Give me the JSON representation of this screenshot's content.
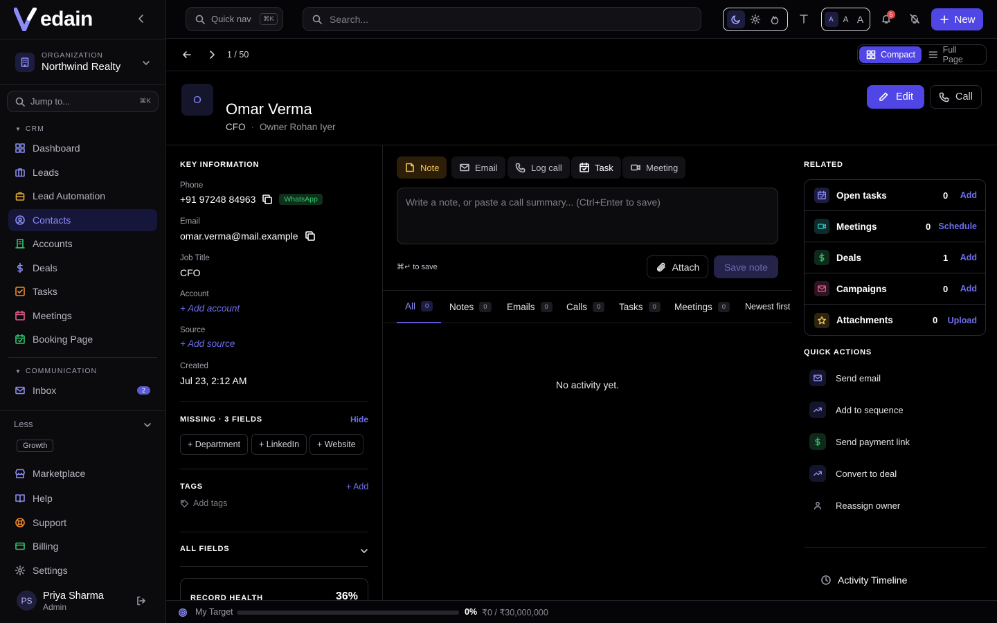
{
  "app": {
    "logo_text": "edain",
    "brand_color": "#4f46e5"
  },
  "org": {
    "label": "ORGANIZATION",
    "name": "Northwind Realty"
  },
  "sidebar": {
    "jump_placeholder": "Jump to...",
    "jump_kbd": "⌘K",
    "crm_header": "CRM",
    "crm_items": [
      {
        "label": "Dashboard",
        "icon": "grid-icon"
      },
      {
        "label": "Leads",
        "icon": "briefcase-icon"
      },
      {
        "label": "Lead Automation",
        "icon": "bag-icon"
      },
      {
        "label": "Contacts",
        "icon": "contact-icon",
        "active": true
      },
      {
        "label": "Accounts",
        "icon": "building-icon"
      },
      {
        "label": "Deals",
        "icon": "dollar-icon"
      },
      {
        "label": "Tasks",
        "icon": "checkbox-icon"
      },
      {
        "label": "Meetings",
        "icon": "calendar-icon"
      },
      {
        "label": "Booking Page",
        "icon": "calendar-check-icon"
      }
    ],
    "comm_header": "COMMUNICATION",
    "comm_items": [
      {
        "label": "Inbox",
        "icon": "mail-icon",
        "badge": "2"
      }
    ],
    "less_label": "Less",
    "plan_badge": "Growth",
    "bottom_items": [
      {
        "label": "Marketplace",
        "icon": "store-icon"
      },
      {
        "label": "Help",
        "icon": "book-icon"
      },
      {
        "label": "Support",
        "icon": "lifebuoy-icon"
      },
      {
        "label": "Billing",
        "icon": "card-icon"
      },
      {
        "label": "Settings",
        "icon": "gear-icon"
      }
    ],
    "user": {
      "initials": "PS",
      "name": "Priya Sharma",
      "role": "Admin"
    }
  },
  "topbar": {
    "quicknav_label": "Quick nav",
    "quicknav_kbd": "⌘K",
    "search_placeholder": "Search...",
    "font_sizes": [
      "A",
      "A",
      "A"
    ],
    "notif_count": "5",
    "new_label": "New"
  },
  "subheader": {
    "pager": "1 / 50",
    "view_compact": "Compact",
    "view_full": "Full Page"
  },
  "record": {
    "initial": "O",
    "name": "Omar Verma",
    "title": "CFO",
    "owner": "Owner Rohan Iyer",
    "edit_label": "Edit",
    "call_label": "Call"
  },
  "info": {
    "header": "KEY INFORMATION",
    "phone_label": "Phone",
    "phone": "+91 97248 84963",
    "whatsapp": "WhatsApp",
    "email_label": "Email",
    "email": "omar.verma@mail.example",
    "job_label": "Job Title",
    "job": "CFO",
    "account_label": "Account",
    "account_add": "+ Add account",
    "source_label": "Source",
    "source_add": "+ Add source",
    "created_label": "Created",
    "created": "Jul 23, 2:12 AM",
    "missing_header": "MISSING · 3 FIELDS",
    "hide_label": "Hide",
    "missing_chips": [
      "+ Department",
      "+ LinkedIn",
      "+ Website"
    ],
    "tags_header": "TAGS",
    "tags_add": "+ Add",
    "tags_placeholder": "Add tags",
    "all_fields_header": "ALL FIELDS",
    "health_label": "RECORD HEALTH",
    "health_value": "36%"
  },
  "composer": {
    "tabs": [
      "Note",
      "Email",
      "Log call",
      "Task",
      "Meeting"
    ],
    "placeholder": "Write a note, or paste a call summary... (Ctrl+Enter to save)",
    "hint": "⌘↵ to save",
    "attach_label": "Attach",
    "save_label": "Save note"
  },
  "activity": {
    "tabs": [
      {
        "label": "All",
        "count": "0"
      },
      {
        "label": "Notes",
        "count": "0"
      },
      {
        "label": "Emails",
        "count": "0"
      },
      {
        "label": "Calls",
        "count": "0"
      },
      {
        "label": "Tasks",
        "count": "0"
      },
      {
        "label": "Meetings",
        "count": "0"
      }
    ],
    "sort_label": "Newest first",
    "empty_text": "No activity yet."
  },
  "related": {
    "header": "RELATED",
    "items": [
      {
        "label": "Open tasks",
        "count": "0",
        "action": "Add",
        "icon": "calendar-check-icon"
      },
      {
        "label": "Meetings",
        "count": "0",
        "action": "Schedule",
        "icon": "video-icon"
      },
      {
        "label": "Deals",
        "count": "1",
        "action": "Add",
        "icon": "dollar-icon"
      },
      {
        "label": "Campaigns",
        "count": "0",
        "action": "Add",
        "icon": "mail-icon"
      },
      {
        "label": "Attachments",
        "count": "0",
        "action": "Upload",
        "icon": "star-icon"
      }
    ]
  },
  "quick_actions": {
    "header": "QUICK ACTIONS",
    "items": [
      "Send email",
      "Add to sequence",
      "Send payment link",
      "Convert to deal",
      "Reassign owner"
    ]
  },
  "timeline": {
    "label": "Activity Timeline"
  },
  "footer": {
    "label": "My Target",
    "progress": 0,
    "pct": "0%",
    "amount": "₹0 / ₹30,000,000"
  }
}
